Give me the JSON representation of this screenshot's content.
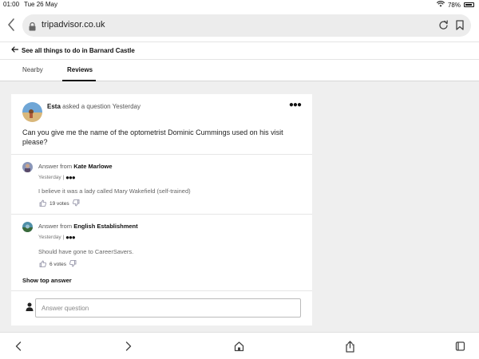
{
  "status": {
    "time": "01:00",
    "date": "Tue 26 May",
    "battery": "78%",
    "battery_level": 0.78
  },
  "browser": {
    "url": "tripadvisor.co.uk"
  },
  "breadcrumb": {
    "label": "See all things to do in Barnard Castle"
  },
  "tabs": [
    {
      "label": "Nearby",
      "active": false
    },
    {
      "label": "Reviews",
      "active": true
    }
  ],
  "question": {
    "author": "Esta",
    "action": "asked a question Yesterday",
    "text": "Can you give me the name of the optometrist Dominic Cummings used on his visit please?",
    "answers": [
      {
        "prefix": "Answer from",
        "author": "Kate Marlowe",
        "date": "Yesterday |",
        "text": "I believe it was a lady called Mary Wakefield (self-trained)",
        "votes": "19 votes"
      },
      {
        "prefix": "Answer from",
        "author": "English Establishment",
        "date": "Yesterday |",
        "text": "Should have gone to CareerSavers.",
        "votes": "6 votes"
      }
    ]
  },
  "show_top_answer": "Show top answer",
  "answer_input": {
    "placeholder": "Answer question"
  },
  "colors": {
    "accent": "#111111",
    "background": "#efefef",
    "muted_text": "#777777"
  },
  "icons": [
    "back-icon",
    "lock-icon",
    "reload-icon",
    "bookmark-icon",
    "wifi-icon",
    "battery-icon",
    "more-icon",
    "thumbs-up-icon",
    "thumbs-down-icon",
    "user-icon",
    "forward-icon",
    "home-icon",
    "share-icon",
    "tabs-icon"
  ]
}
